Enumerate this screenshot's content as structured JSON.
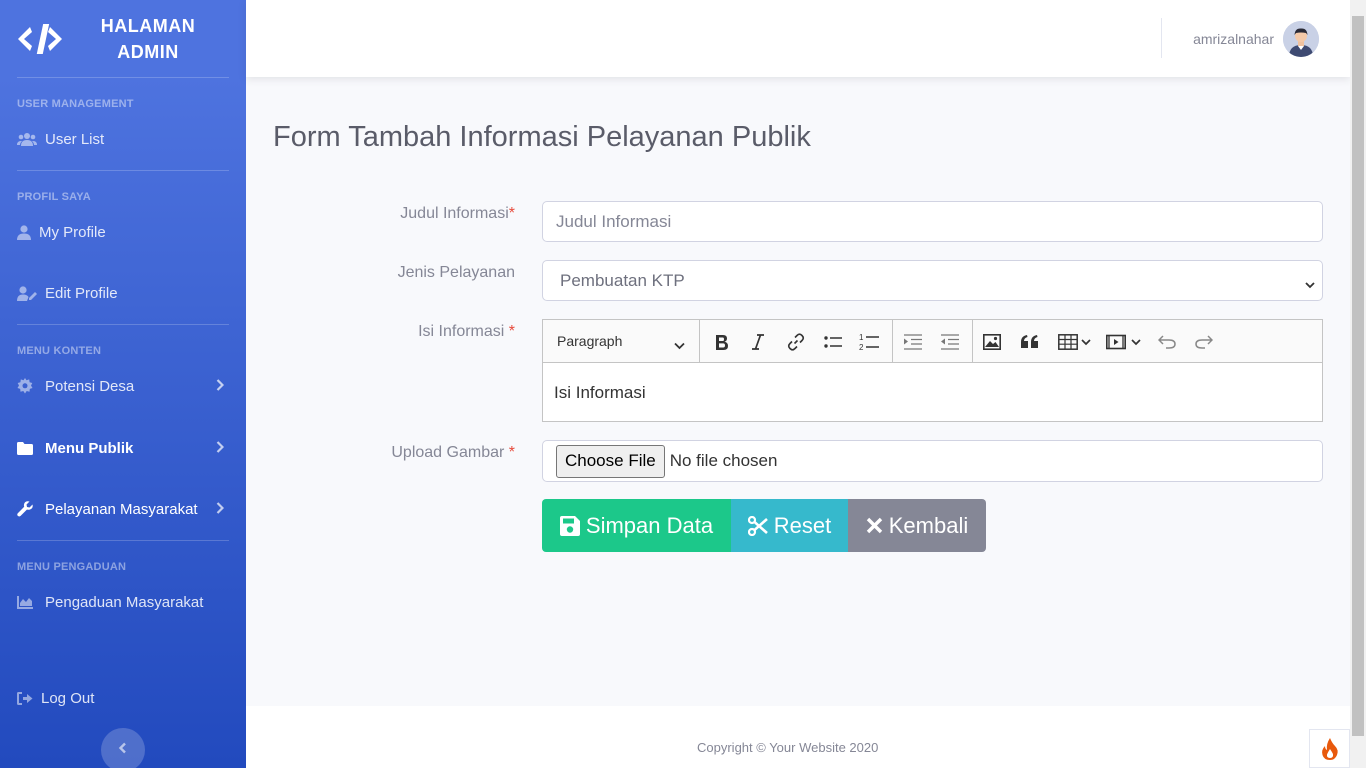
{
  "brand": {
    "title_line1": "HALAMAN",
    "title_line2": "ADMIN"
  },
  "sidebar": {
    "sections": [
      {
        "heading": "USER MANAGEMENT"
      },
      {
        "heading": "PROFIL SAYA"
      },
      {
        "heading": "MENU KONTEN"
      },
      {
        "heading": "MENU PENGADUAN"
      }
    ],
    "items": [
      {
        "label": "User List",
        "icon": "users-icon"
      },
      {
        "label": "My Profile",
        "icon": "user-icon"
      },
      {
        "label": "Edit Profile",
        "icon": "user-edit-icon"
      },
      {
        "label": "Potensi Desa",
        "icon": "gear-icon"
      },
      {
        "label": "Menu Publik",
        "icon": "folder-icon",
        "active": true
      },
      {
        "label": "Pelayanan Masyarakat",
        "icon": "wrench-icon"
      },
      {
        "label": "Pengaduan Masyarakat",
        "icon": "chart-area-icon"
      },
      {
        "label": "Log Out",
        "icon": "sign-out-icon"
      }
    ]
  },
  "topbar": {
    "username": "amrizalnahar"
  },
  "form": {
    "title": "Form Tambah Informasi Pelayanan Publik",
    "judul_label": "Judul Informasi",
    "judul_placeholder": "Judul Informasi",
    "jenis_label": "Jenis Pelayanan",
    "jenis_value": "Pembuatan KTP",
    "isi_label": "Isi Informasi ",
    "editor_heading_value": "Paragraph",
    "editor_placeholder": "Isi Informasi",
    "upload_label": "Upload Gambar ",
    "choose_file": "Choose File",
    "no_file": "No file chosen",
    "required_mark": "*"
  },
  "buttons": {
    "save": "Simpan Data",
    "reset": "Reset",
    "back": "Kembali"
  },
  "footer": {
    "copyright": "Copyright © Your Website 2020"
  },
  "colors": {
    "primary": "#4e73df",
    "success": "#1cc88a",
    "info": "#36b9cc",
    "secondary": "#858796",
    "danger": "#e74a3b"
  }
}
